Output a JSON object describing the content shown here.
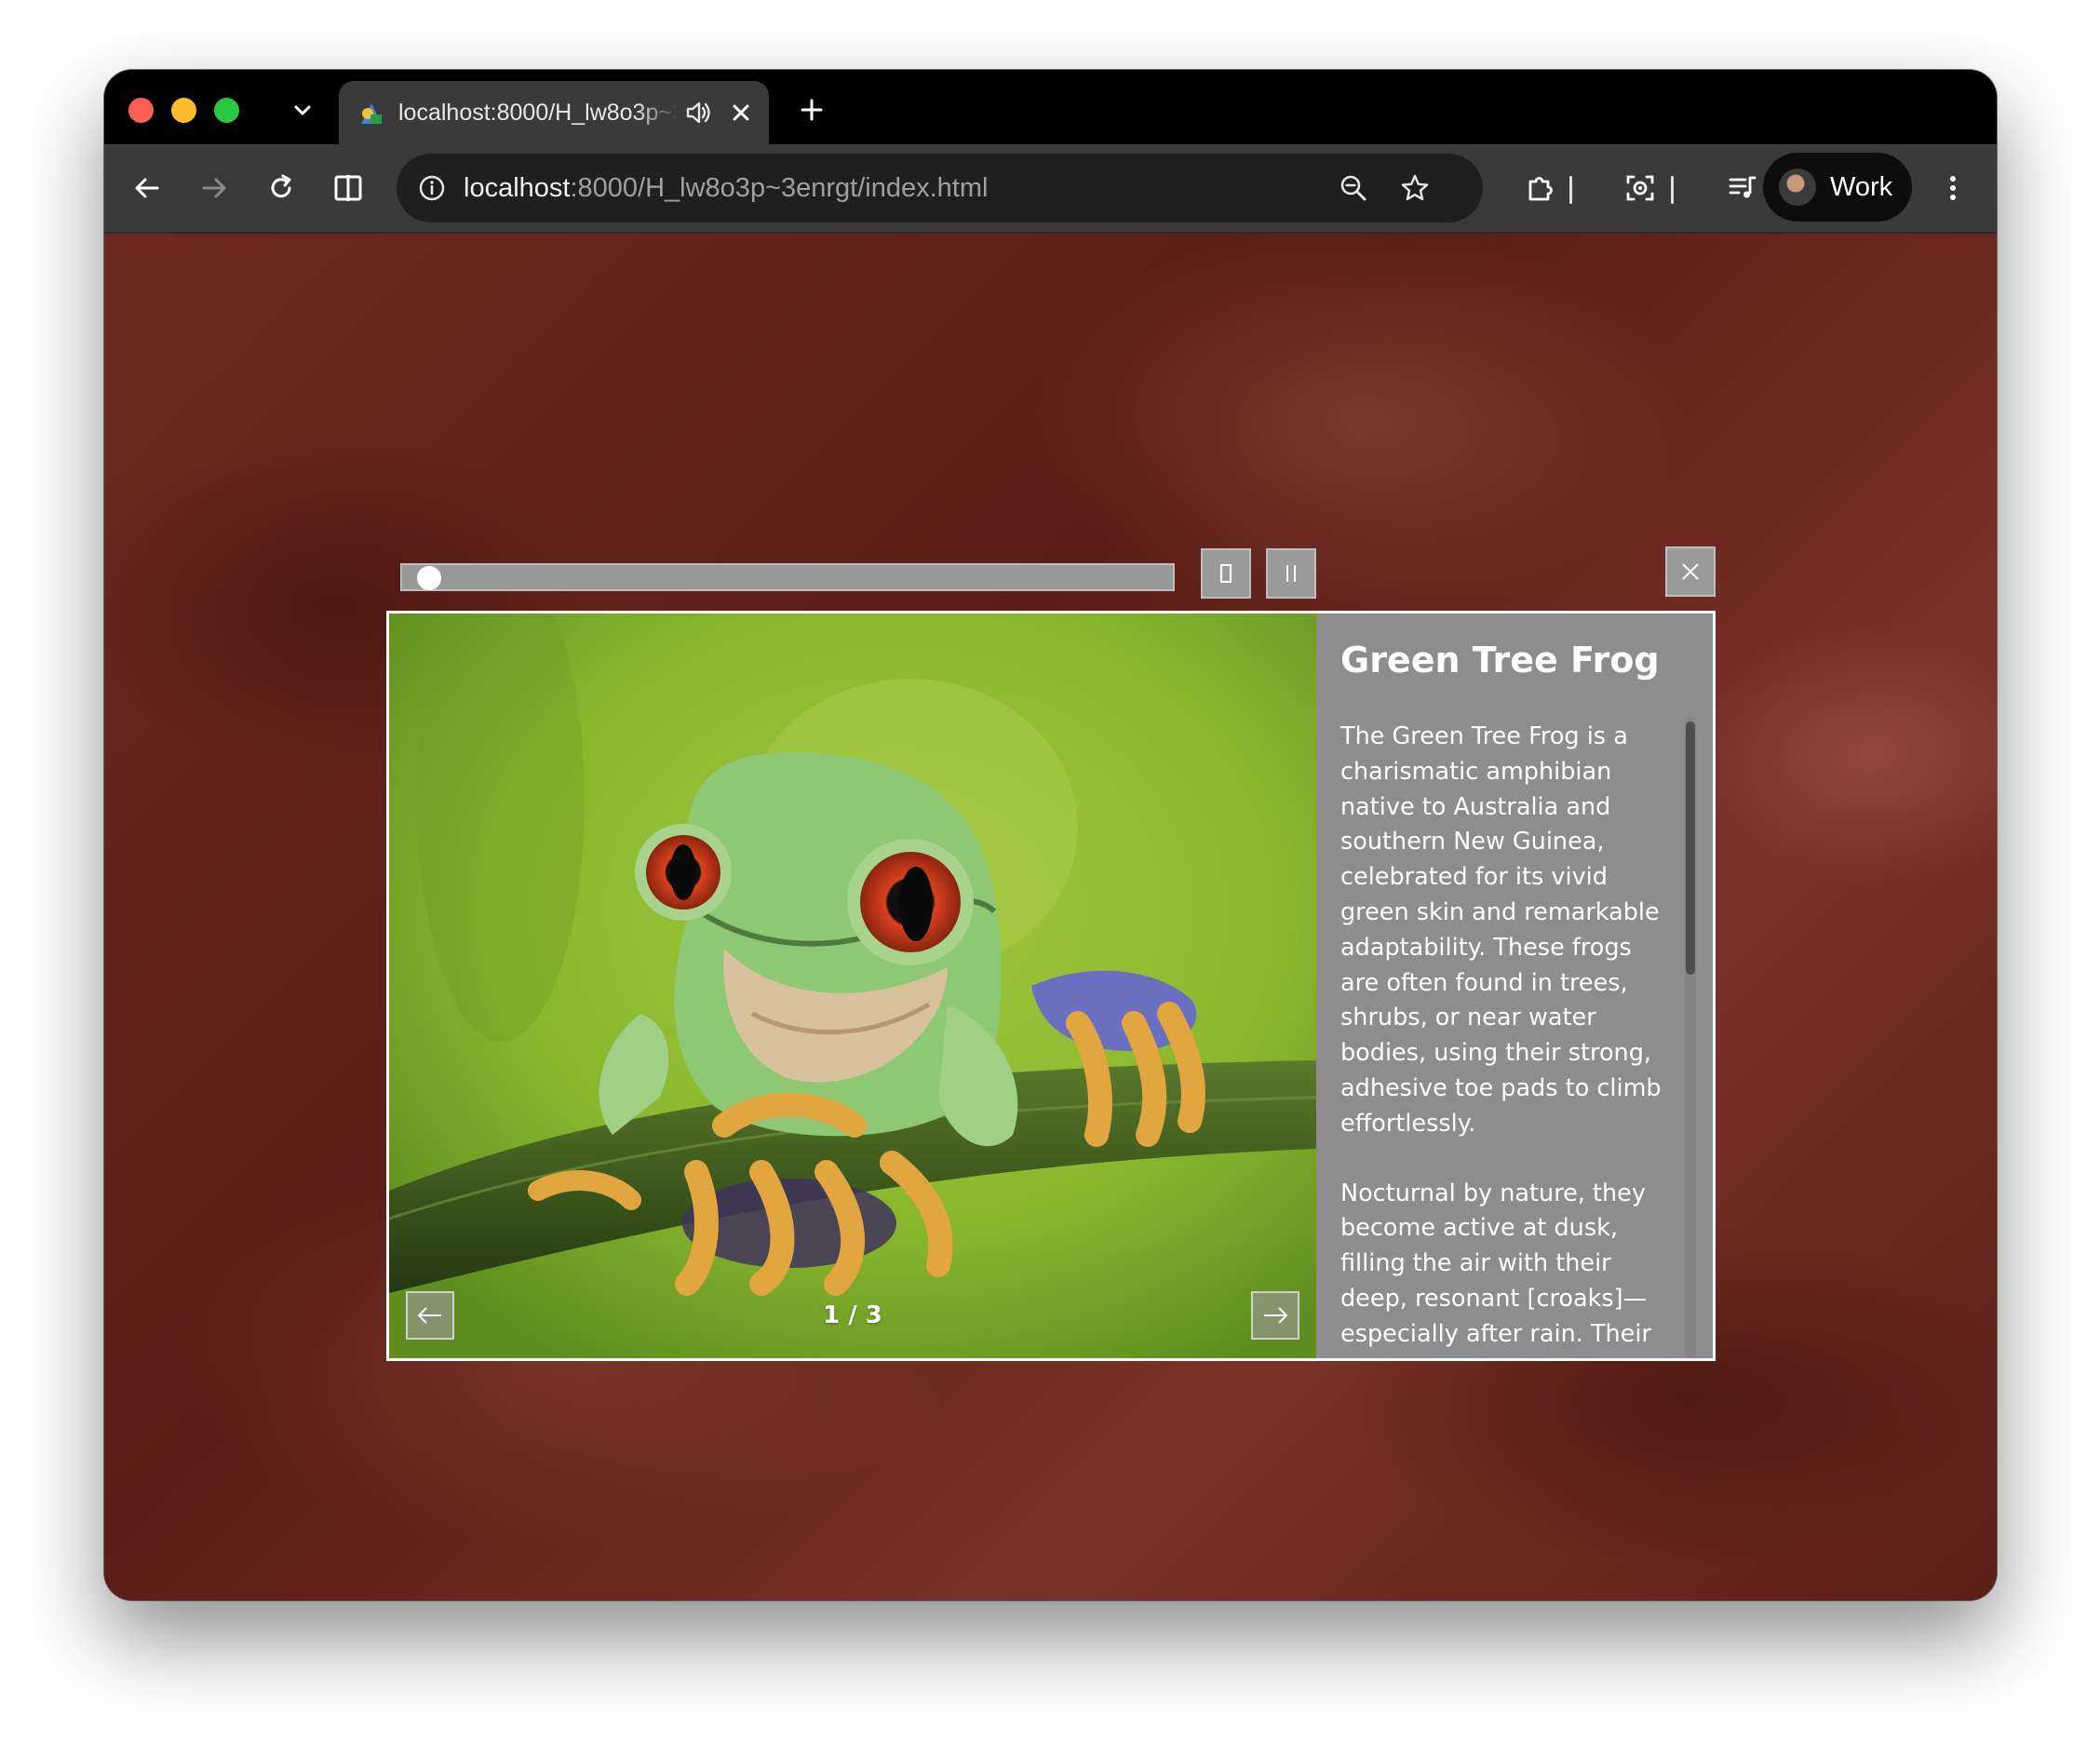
{
  "browser": {
    "tab": {
      "title": "localhost:8000/H_lw8o3p~3enrgt/index.html"
    },
    "address_bar": {
      "host": "localhost",
      "path": ":8000/H_lw8o3p~3enrgt/index.html"
    },
    "profile": {
      "name": "Work"
    }
  },
  "lightbox": {
    "progress": 0.02,
    "counter": "1 / 3",
    "title": "Green Tree Frog",
    "description": [
      "The Green Tree Frog is a charismatic amphibian native to Australia and southern New Guinea, celebrated for its vivid green skin and remarkable adaptability. These frogs are often found in trees, shrubs, or near water bodies, using their strong, adhesive toe pads to climb effortlessly.",
      "Nocturnal by nature, they become active at dusk, filling the air with their deep, resonant [croaks]—especially after rain. Their"
    ]
  },
  "colors": {
    "tab_strip": "#000000",
    "toolbar": "#3a3a3a",
    "page_background": "#6e2a22",
    "panel": "#8d8d8d"
  }
}
